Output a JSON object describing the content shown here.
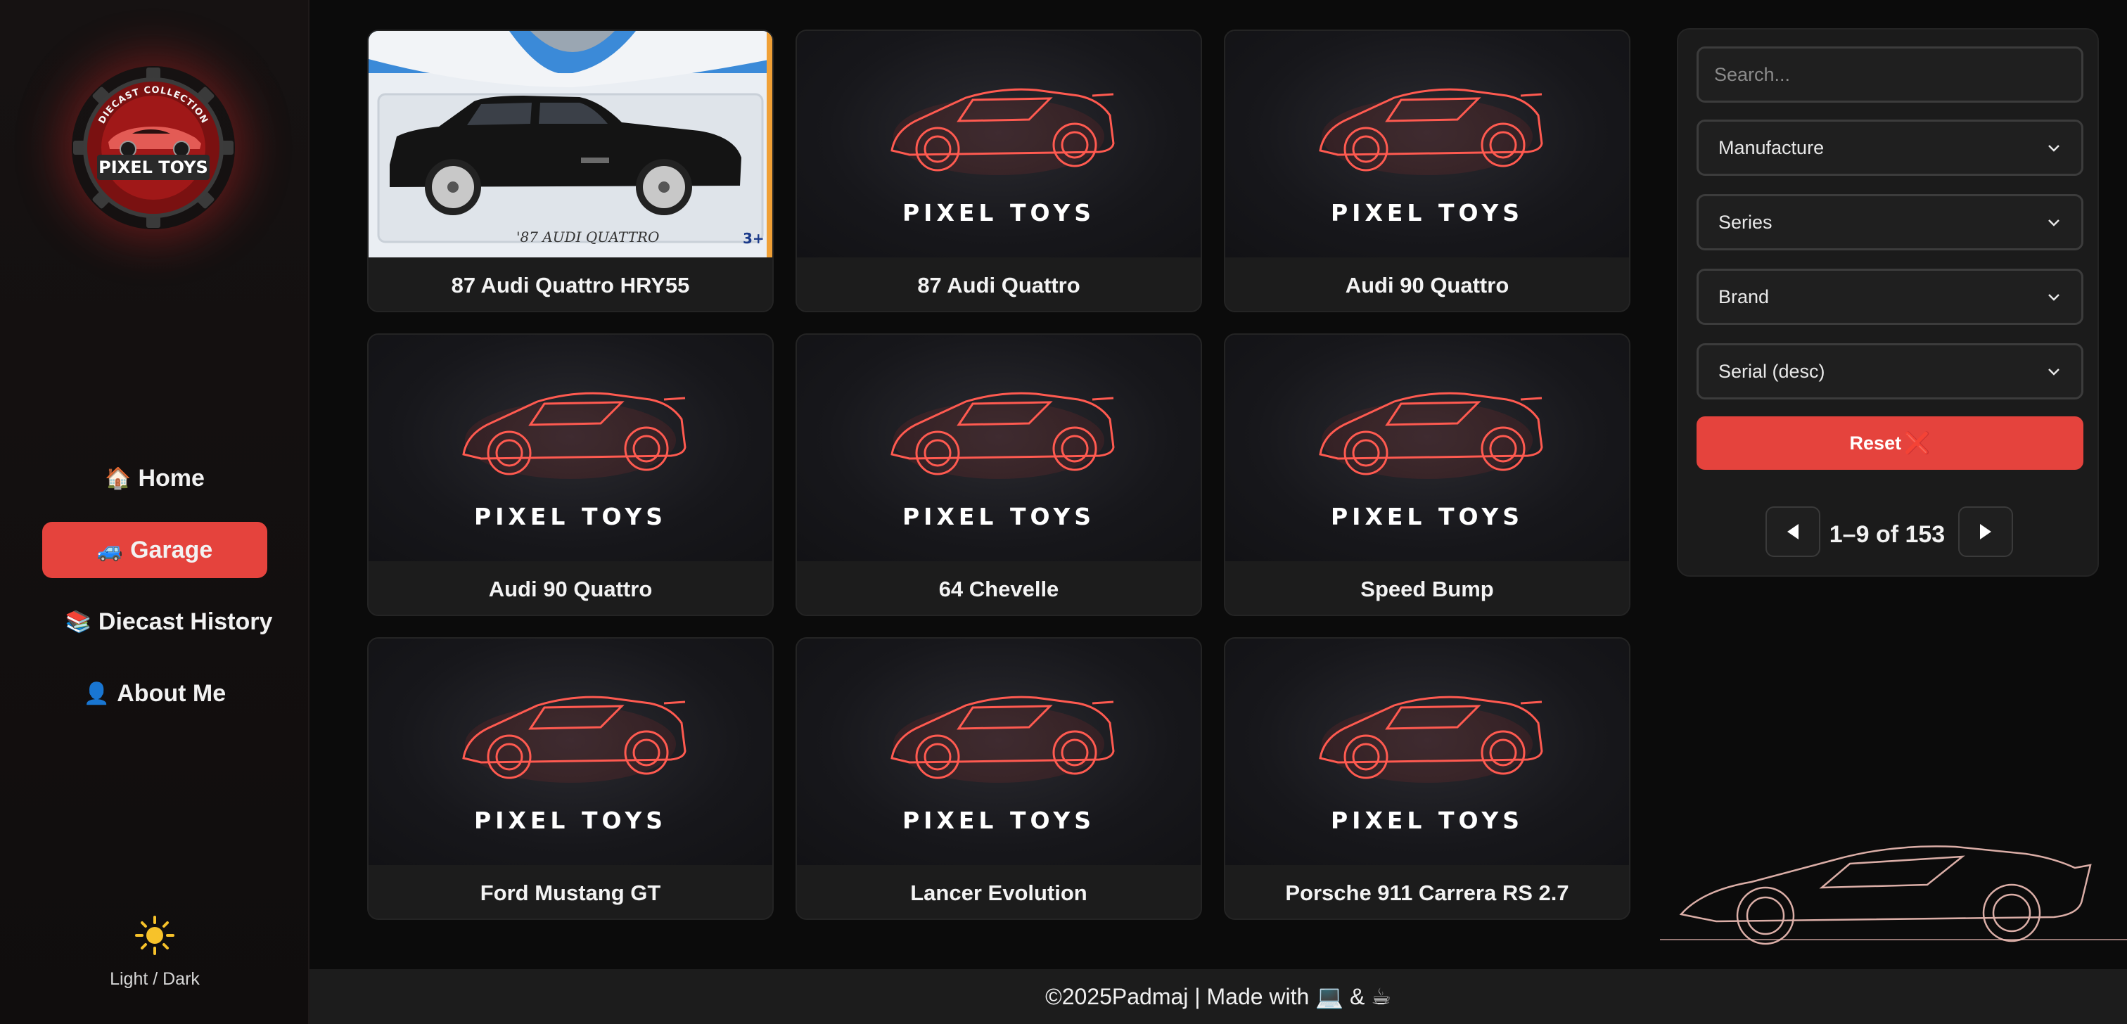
{
  "sidebar": {
    "logo": {
      "arc_text": "DIECAST COLLECTION",
      "name": "PIXEL TOYS"
    },
    "nav": [
      {
        "icon": "house-icon",
        "emoji": "🏠",
        "label": "Home",
        "active": false
      },
      {
        "icon": "car-icon",
        "emoji": "🚙",
        "label": "Garage",
        "active": true
      },
      {
        "icon": "books-icon",
        "emoji": "📚",
        "label": "Diecast History",
        "active": false
      },
      {
        "icon": "user-icon",
        "emoji": "👤",
        "label": "About Me",
        "active": false
      }
    ],
    "theme_icon": "sun-icon",
    "theme_label": "Light / Dark"
  },
  "grid": {
    "placeholder_brand": "PIXEL TOYS",
    "cards": [
      {
        "name": "87 Audi Quattro HRY55",
        "image": "photo-black-audi-quattro"
      },
      {
        "name": "87 Audi Quattro",
        "image": "placeholder"
      },
      {
        "name": "Audi 90 Quattro",
        "image": "placeholder"
      },
      {
        "name": "Audi 90 Quattro",
        "image": "placeholder"
      },
      {
        "name": "64 Chevelle",
        "image": "placeholder"
      },
      {
        "name": "Speed Bump",
        "image": "placeholder"
      },
      {
        "name": "Ford Mustang GT",
        "image": "placeholder"
      },
      {
        "name": "Lancer Evolution",
        "image": "placeholder"
      },
      {
        "name": "Porsche 911 Carrera RS 2.7",
        "image": "placeholder"
      }
    ],
    "photo_card_text": {
      "package_label": "'87 AUDI QUATTRO",
      "age_badge": "3+"
    }
  },
  "filters": {
    "search_placeholder": "Search...",
    "manufacture": "Manufacture",
    "series": "Series",
    "brand": "Brand",
    "sort": "Serial (desc)",
    "reset_label": "Reset",
    "reset_icon": "❌",
    "pagination": {
      "text": "1–9 of 153",
      "prev_icon": "triangle-left-icon",
      "next_icon": "triangle-right-icon"
    }
  },
  "footer": {
    "text": "©2025Padmaj | Made with 💻 & ☕"
  },
  "colors": {
    "accent": "#e5433d",
    "neon": "#ff5a50",
    "background": "#0b0b0b"
  }
}
